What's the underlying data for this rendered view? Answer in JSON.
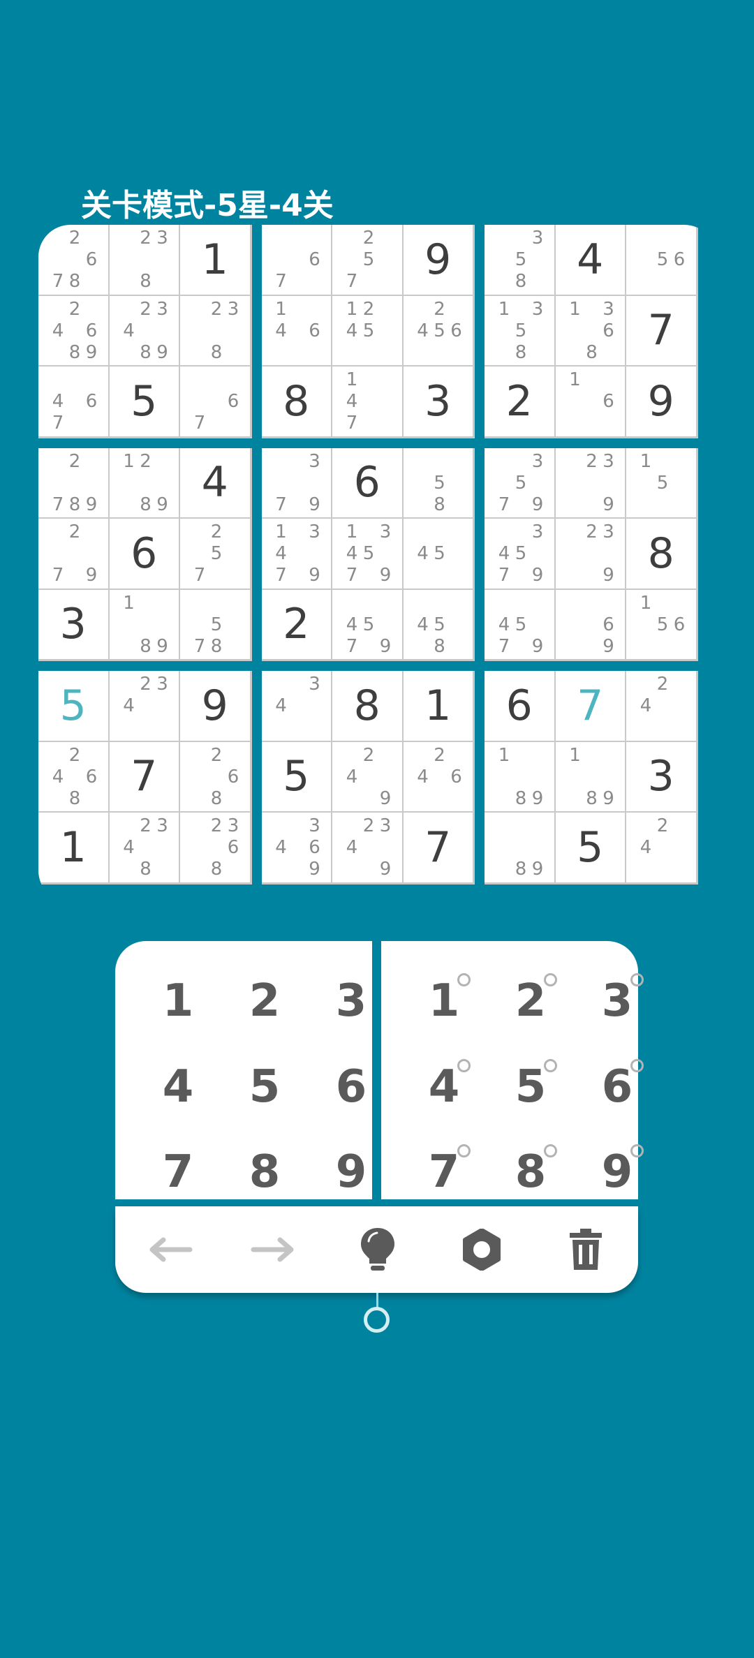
{
  "title": "关卡模式-5星-4关",
  "colors": {
    "background": "#00839f",
    "given": "#3e3e3e",
    "user": "#4db4c0",
    "candidate": "#8a8a8a",
    "key": "#5a5a5a"
  },
  "grid": [
    [
      {
        "c": [
          2,
          6,
          7,
          8
        ]
      },
      {
        "c": [
          2,
          3,
          8
        ]
      },
      {
        "v": "1"
      },
      {
        "c": [
          6,
          7
        ]
      },
      {
        "c": [
          2,
          5,
          7
        ]
      },
      {
        "v": "9"
      },
      {
        "c": [
          3,
          5,
          8
        ]
      },
      {
        "v": "4"
      },
      {
        "c": [
          5,
          6
        ]
      }
    ],
    [
      {
        "c": [
          2,
          4,
          6,
          8,
          9
        ]
      },
      {
        "c": [
          2,
          3,
          4,
          8,
          9
        ]
      },
      {
        "c": [
          2,
          3,
          8
        ]
      },
      {
        "c": [
          1,
          4,
          6
        ]
      },
      {
        "c": [
          1,
          2,
          4,
          5
        ]
      },
      {
        "c": [
          2,
          4,
          5,
          6
        ]
      },
      {
        "c": [
          1,
          3,
          5,
          8
        ]
      },
      {
        "c": [
          1,
          3,
          6,
          8
        ]
      },
      {
        "v": "7"
      }
    ],
    [
      {
        "c": [
          4,
          6,
          7
        ]
      },
      {
        "v": "5"
      },
      {
        "c": [
          6,
          7
        ]
      },
      {
        "v": "8"
      },
      {
        "c": [
          1,
          4,
          7
        ]
      },
      {
        "v": "3"
      },
      {
        "v": "2"
      },
      {
        "c": [
          1,
          6
        ]
      },
      {
        "v": "9"
      }
    ],
    [
      {
        "c": [
          2,
          7,
          8,
          9
        ]
      },
      {
        "c": [
          1,
          2,
          8,
          9
        ]
      },
      {
        "v": "4"
      },
      {
        "c": [
          3,
          7,
          9
        ]
      },
      {
        "v": "6"
      },
      {
        "c": [
          5,
          8
        ]
      },
      {
        "c": [
          3,
          5,
          7,
          9
        ]
      },
      {
        "c": [
          2,
          3,
          9
        ]
      },
      {
        "c": [
          1,
          5
        ]
      }
    ],
    [
      {
        "c": [
          2,
          7,
          9
        ]
      },
      {
        "v": "6"
      },
      {
        "c": [
          2,
          5,
          7
        ]
      },
      {
        "c": [
          1,
          3,
          4,
          7,
          9
        ]
      },
      {
        "c": [
          1,
          3,
          4,
          5,
          7,
          9
        ]
      },
      {
        "c": [
          4,
          5
        ]
      },
      {
        "c": [
          3,
          4,
          5,
          7,
          9
        ]
      },
      {
        "c": [
          2,
          3,
          9
        ]
      },
      {
        "v": "8"
      }
    ],
    [
      {
        "v": "3"
      },
      {
        "c": [
          1,
          8,
          9
        ]
      },
      {
        "c": [
          5,
          7,
          8
        ]
      },
      {
        "v": "2"
      },
      {
        "c": [
          4,
          5,
          7,
          9
        ]
      },
      {
        "c": [
          4,
          5,
          8
        ]
      },
      {
        "c": [
          4,
          5,
          7,
          9
        ]
      },
      {
        "c": [
          6,
          9
        ]
      },
      {
        "c": [
          1,
          5,
          6
        ]
      }
    ],
    [
      {
        "v": "5",
        "u": true
      },
      {
        "c": [
          2,
          3,
          4
        ]
      },
      {
        "v": "9"
      },
      {
        "c": [
          3,
          4
        ]
      },
      {
        "v": "8"
      },
      {
        "v": "1"
      },
      {
        "v": "6"
      },
      {
        "v": "7",
        "u": true
      },
      {
        "c": [
          2,
          4
        ]
      }
    ],
    [
      {
        "c": [
          2,
          4,
          6,
          8
        ]
      },
      {
        "v": "7"
      },
      {
        "c": [
          2,
          6,
          8
        ]
      },
      {
        "v": "5"
      },
      {
        "c": [
          2,
          4,
          9
        ]
      },
      {
        "c": [
          2,
          4,
          6
        ]
      },
      {
        "c": [
          1,
          8,
          9
        ]
      },
      {
        "c": [
          1,
          8,
          9
        ]
      },
      {
        "v": "3"
      }
    ],
    [
      {
        "v": "1"
      },
      {
        "c": [
          2,
          3,
          4,
          8
        ]
      },
      {
        "c": [
          2,
          3,
          6,
          8
        ]
      },
      {
        "c": [
          3,
          4,
          6,
          9
        ]
      },
      {
        "c": [
          2,
          3,
          4,
          9
        ]
      },
      {
        "v": "7"
      },
      {
        "c": [
          8,
          9
        ]
      },
      {
        "v": "5"
      },
      {
        "c": [
          2,
          4
        ]
      }
    ]
  ],
  "number_pad": [
    "1",
    "2",
    "3",
    "4",
    "5",
    "6",
    "7",
    "8",
    "9"
  ],
  "note_pad": [
    "1",
    "2",
    "3",
    "4",
    "5",
    "6",
    "7",
    "8",
    "9"
  ],
  "toolbar": {
    "tools": [
      {
        "name": "undo-arrow-icon",
        "color": "#c4c4c4"
      },
      {
        "name": "redo-arrow-icon",
        "color": "#c4c4c4"
      },
      {
        "name": "hint-bulb-icon",
        "color": "#5a5a5a"
      },
      {
        "name": "settings-gear-icon",
        "color": "#5a5a5a"
      },
      {
        "name": "delete-trash-icon",
        "color": "#5a5a5a"
      }
    ]
  }
}
